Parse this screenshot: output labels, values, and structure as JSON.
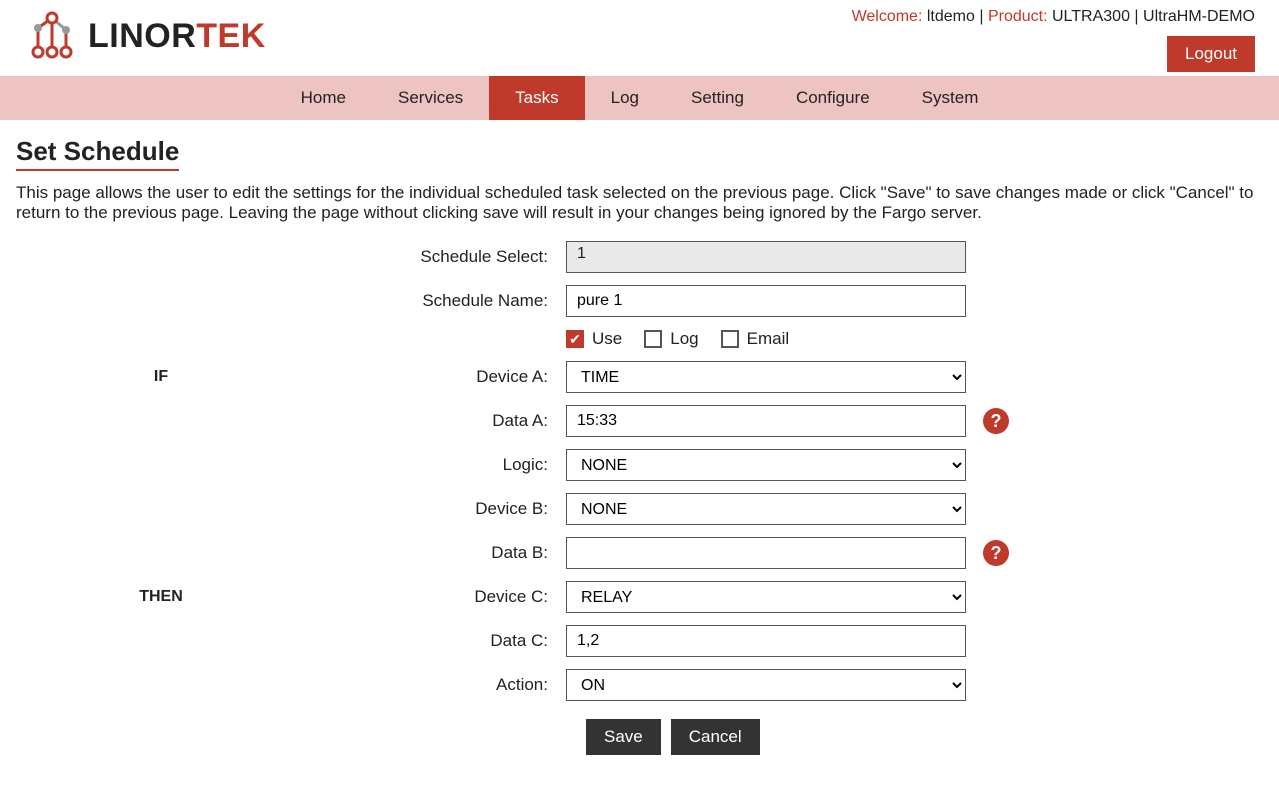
{
  "header": {
    "brand_left": "LINOR",
    "brand_right": "TEK",
    "welcome_label": "Welcome:",
    "welcome_user": "ltdemo",
    "sep": " | ",
    "product_label": "Product:",
    "product_value": "ULTRA300 | UltraHM-DEMO",
    "logout": "Logout"
  },
  "nav": {
    "items": [
      "Home",
      "Services",
      "Tasks",
      "Log",
      "Setting",
      "Configure",
      "System"
    ],
    "active": "Tasks"
  },
  "page": {
    "title": "Set Schedule",
    "description": "This page allows the user to edit the settings for the individual scheduled task selected on the previous page. Click \"Save\" to save changes made or click \"Cancel\" to return to the previous page. Leaving the page without clicking save will result in your changes being ignored by the Fargo server."
  },
  "form": {
    "schedule_select_label": "Schedule Select:",
    "schedule_select_value": "1",
    "schedule_name_label": "Schedule Name:",
    "schedule_name_value": "pure 1",
    "use_label": "Use",
    "use_checked": true,
    "log_label": "Log",
    "log_checked": false,
    "email_label": "Email",
    "email_checked": false,
    "if_label": "IF",
    "then_label": "THEN",
    "deviceA_label": "Device A:",
    "deviceA_value": "TIME",
    "dataA_label": "Data A:",
    "dataA_value": "15:33",
    "logic_label": "Logic:",
    "logic_value": "NONE",
    "deviceB_label": "Device B:",
    "deviceB_value": "NONE",
    "dataB_label": "Data B:",
    "dataB_value": "",
    "deviceC_label": "Device C:",
    "deviceC_value": "RELAY",
    "dataC_label": "Data C:",
    "dataC_value": "1,2",
    "action_label": "Action:",
    "action_value": "ON",
    "save": "Save",
    "cancel": "Cancel",
    "help": "?"
  }
}
